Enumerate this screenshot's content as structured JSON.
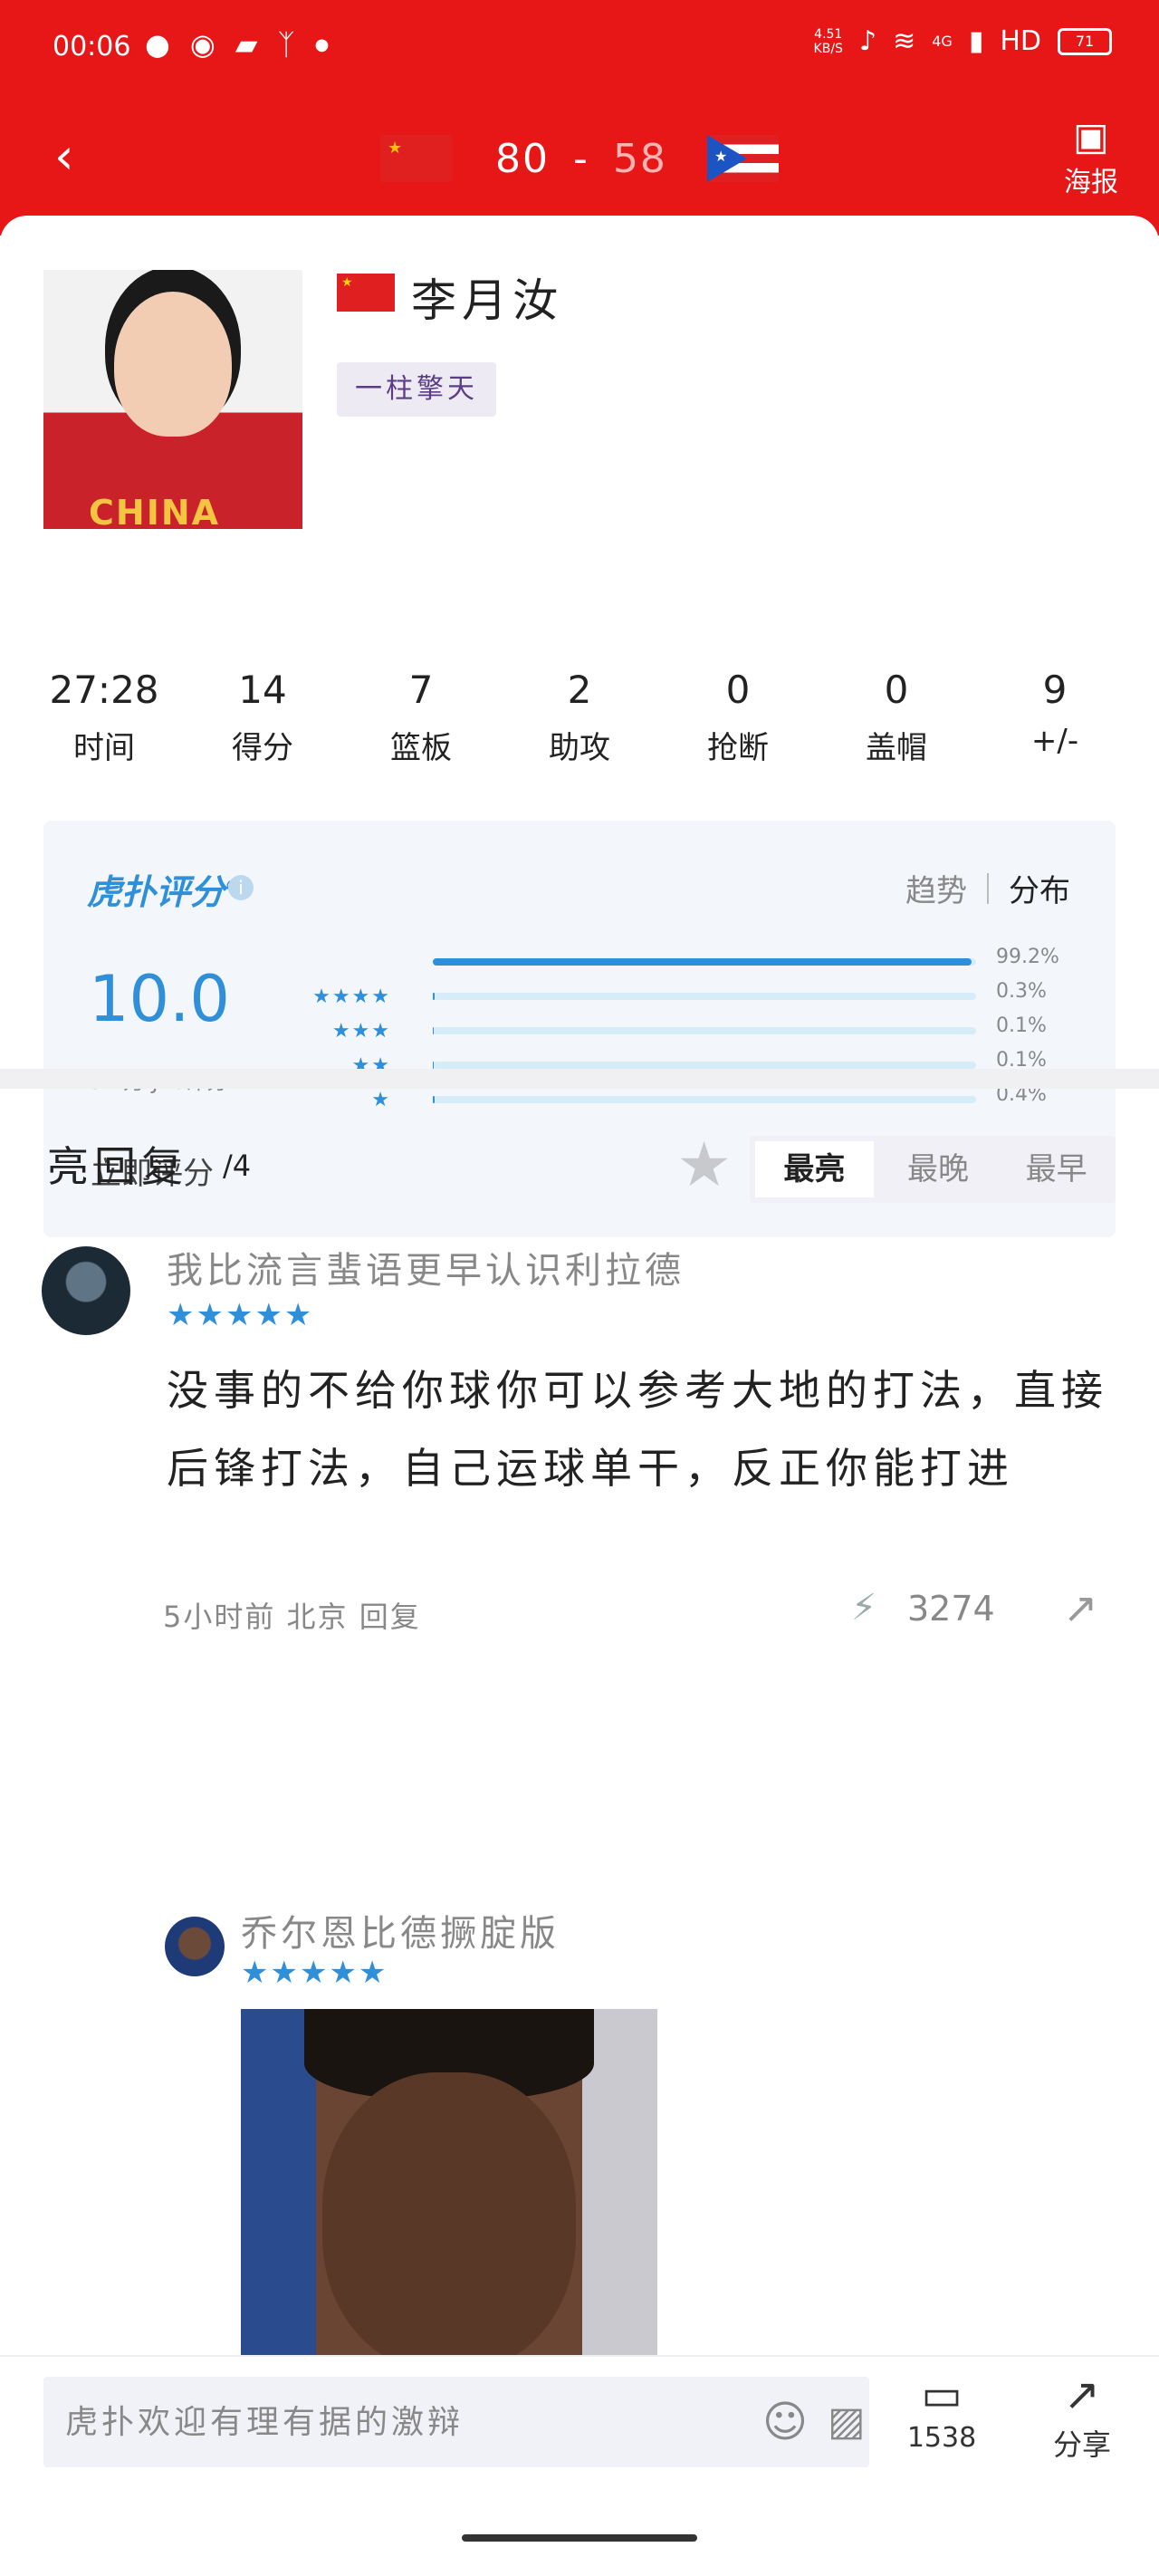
{
  "status_bar": {
    "time": "00:06",
    "net_speed_value": "4.51",
    "net_speed_unit": "KB/S",
    "network": "4G",
    "hd": "HD",
    "battery": "71",
    "app_icons": [
      "message-icon",
      "chat-icon",
      "car-icon",
      "walk-icon",
      "dot-icon"
    ]
  },
  "header": {
    "home_score": "80",
    "separator": "-",
    "away_score": "58",
    "poster_label": "海报"
  },
  "player": {
    "name": "李月汝",
    "tag": "一柱擎天",
    "photo_text": "CHINA"
  },
  "stats": [
    {
      "value": "27:28",
      "label": "时间"
    },
    {
      "value": "14",
      "label": "得分"
    },
    {
      "value": "7",
      "label": "篮板"
    },
    {
      "value": "2",
      "label": "助攻"
    },
    {
      "value": "0",
      "label": "抢断"
    },
    {
      "value": "0",
      "label": "盖帽"
    },
    {
      "value": "9",
      "label": "+/-"
    }
  ],
  "rating": {
    "logo": "虎扑评分",
    "logo_mark": "®",
    "tab_trend": "趋势",
    "tab_dist": "分布",
    "score": "10.0",
    "count": "3.7万 JRs评分",
    "rate_now": "立即评分",
    "distribution": [
      {
        "stars": "★★★★★",
        "pct": "99.2%",
        "value": 0.992
      },
      {
        "stars": "★★★★",
        "pct": "0.3%",
        "value": 0.003
      },
      {
        "stars": "★★★",
        "pct": "0.1%",
        "value": 0.001
      },
      {
        "stars": "★★",
        "pct": "0.1%",
        "value": 0.001
      },
      {
        "stars": "★",
        "pct": "0.4%",
        "value": 0.004
      }
    ]
  },
  "replies": {
    "title": "亮回复",
    "count": "/4",
    "sort_tabs": [
      "最亮",
      "最晚",
      "最早"
    ],
    "comment": {
      "user": "我比流言蜚语更早认识利拉德",
      "stars": "★★★★★",
      "body": "没事的不给你球你可以参考大地的打法，直接后锋打法，自己运球单干，反正你能打进",
      "meta": "5小时前  北京  回复",
      "likes": "3274"
    },
    "sub_comment": {
      "user": "乔尔恩比德撅腚版",
      "stars": "★★★★★"
    }
  },
  "bottom_bar": {
    "input_placeholder": "虎扑欢迎有理有据的激辩",
    "comment_count": "1538",
    "share_label": "分享"
  },
  "colors": {
    "header_red": "#e81717",
    "accent_blue": "#2f8fd8",
    "tag_purple": "#5b3d86"
  }
}
